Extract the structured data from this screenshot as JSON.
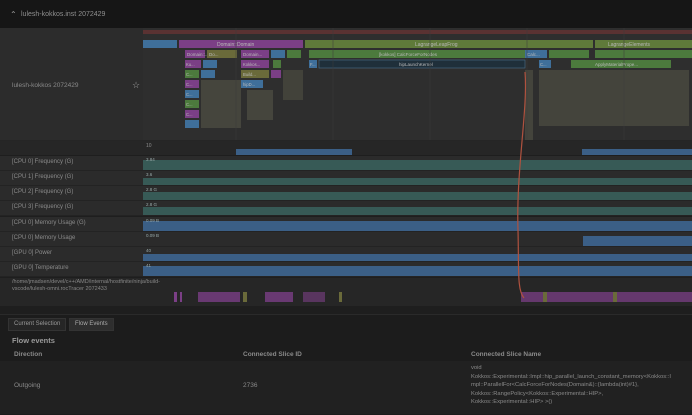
{
  "header": {
    "title": "lulesh-kokkos.inst 2072429"
  },
  "process_track": {
    "label": "lulesh-kokkos 2072429"
  },
  "slices": {
    "domain_domain": "Domain::Domain",
    "lagrange_leapfrog": "LagrangeLeapFrog",
    "lagrange_elements": "LagrangeElements",
    "calc_force": "[kokkos] CalcForceForNodes",
    "hip_launch": "hipLaunchKernel",
    "apply_material": "ApplyMaterialPrope...",
    "kokkos_small": "[kokkos]",
    "calc_short": "Calc...",
    "domain_short": "Domain...",
    "domain_c": "Domain::...",
    "domain_do": "Do...",
    "build": "Build...",
    "hipd": "hipD...",
    "hip_init": "hip:Init...",
    "c_short": "C...",
    "ku": "Ku...",
    "f": "F...",
    "kokkos_k": "Kokkos...",
    "mini_value": "10"
  },
  "counters": [
    {
      "label": "[CPU 0] Frequency (G)",
      "value": "3.84"
    },
    {
      "label": "[CPU 1] Frequency (G)",
      "value": "3.6"
    },
    {
      "label": "[CPU 2] Frequency (G)",
      "value": "2.8 G"
    },
    {
      "label": "[CPU 3] Frequency (G)",
      "value": "2.8 G"
    },
    {
      "label": "[CPU 0] Memory Usage (G)",
      "value": "0.09 B"
    },
    {
      "label": "[CPU 0] Memory Usage",
      "value": "0.09 B"
    },
    {
      "label": "[GPU 0] Power",
      "value": "40"
    },
    {
      "label": "[GPU 0] Temperature",
      "value": "41"
    }
  ],
  "path_label": "/home/jmadsen/devel/c++/AMD/internal/hostfinite/ninja/build-vscode/lulesh-omni.rocTracer 2072433",
  "tabs": {
    "current_selection": "Current Selection",
    "flow_events": "Flow Events"
  },
  "panel": {
    "title": "Flow events",
    "columns": {
      "direction": "Direction",
      "slice_id": "Connected Slice ID",
      "slice_name": "Connected Slice Name"
    },
    "row": {
      "direction": "Outgoing",
      "slice_id": "2736",
      "slice_name_lines": [
        "void",
        "Kokkos::Experimental::Impl::hip_parallel_launch_constant_memory<Kokkos::I",
        "mpl::ParallelFor<CalcForceForNodes(Domain&)::{lambda(int)#1},",
        "Kokkos::RangePolicy<Kokkos::Experimental::HIP>,",
        "Kokkos::Experimental::HIP> >()"
      ]
    }
  },
  "colors": {
    "blue": "#3f6f9a",
    "purple": "#7b3f86",
    "green": "#4c7a3d",
    "teal_counter": "#3f6a66",
    "counter_fill": "#3a5d59",
    "flow_arrow": "#b0523f"
  }
}
